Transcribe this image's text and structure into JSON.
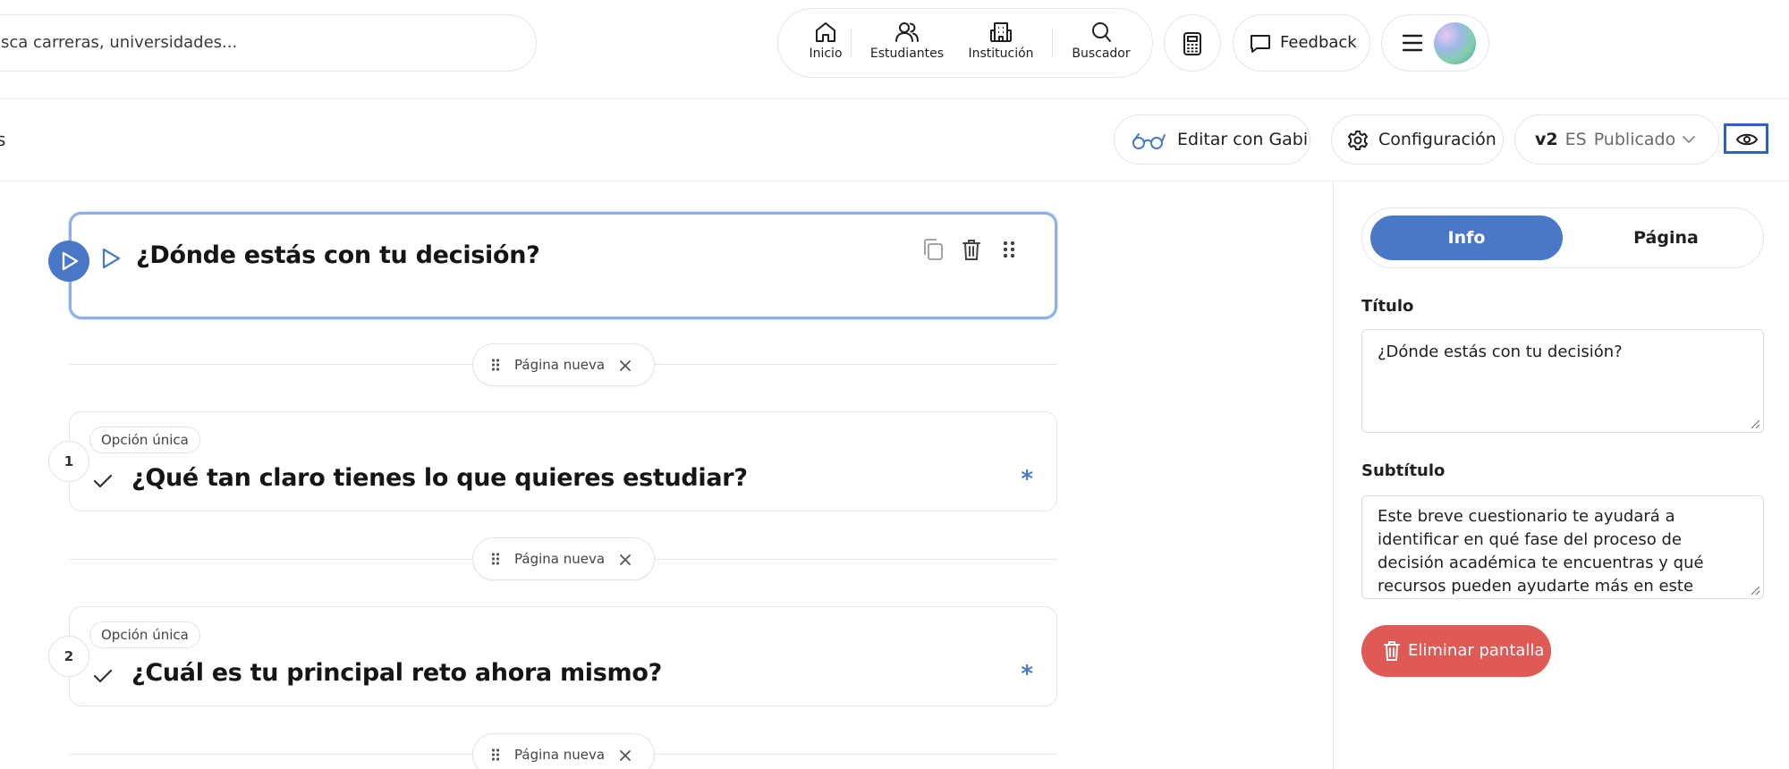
{
  "header": {
    "search_text": "sca carreras, universidades...",
    "nav": [
      {
        "label": "Inicio",
        "icon": "home-icon"
      },
      {
        "label": "Estudiantes",
        "icon": "users-icon"
      },
      {
        "label": "Institución",
        "icon": "building-icon"
      },
      {
        "label": "Buscador",
        "icon": "search-icon"
      }
    ],
    "feedback_label": "Feedback"
  },
  "toolbar": {
    "breadcrumb_fragment": "s",
    "gabi_label": "Editar con Gabi",
    "config_label": "Configuración",
    "version": {
      "number": "v2",
      "lang": "ES",
      "status": "Publicado"
    }
  },
  "canvas": {
    "intro_card": {
      "title": "¿Dónde estás con tu decisión?"
    },
    "page_break_label": "Página nueva",
    "questions": [
      {
        "number": "1",
        "type": "Opción única",
        "title": "¿Qué tan claro tienes lo que quieres estudiar?",
        "required_mark": "*"
      },
      {
        "number": "2",
        "type": "Opción única",
        "title": "¿Cuál es tu principal reto ahora mismo?",
        "required_mark": "*"
      }
    ]
  },
  "panel": {
    "tabs": {
      "info": "Info",
      "page": "Página"
    },
    "active_tab": "Info",
    "title_label": "Título",
    "title_value": "¿Dónde estás con tu decisión?",
    "subtitle_label": "Subtítulo",
    "subtitle_value": "Este breve cuestionario te ayudará a identificar en qué fase del proceso de decisión académica te encuentras y qué recursos pueden ayudarte más en este momento.",
    "delete_label": "Eliminar pantalla"
  },
  "colors": {
    "accent": "#4a78c8",
    "danger": "#e05a55",
    "focus_outline": "#2d5ec9"
  }
}
